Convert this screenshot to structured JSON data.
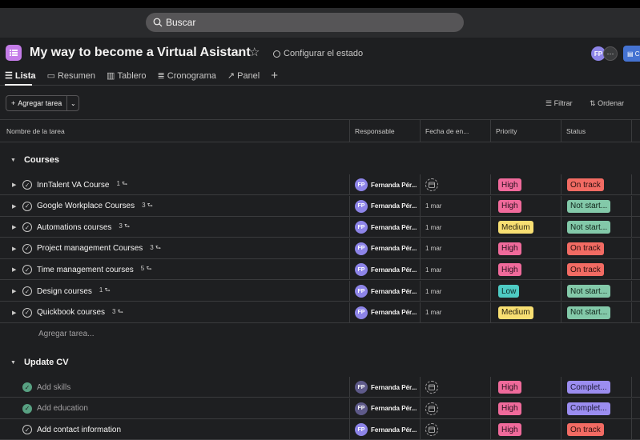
{
  "topbar": {
    "search_placeholder": "Buscar"
  },
  "project": {
    "title": "My way to become a Virtual Asistant",
    "status_cfg": "Configurar el estado",
    "avatar": "FP",
    "more": "···",
    "share_btn": "C"
  },
  "tabs": [
    {
      "label": "Lista",
      "icon": "list-icon"
    },
    {
      "label": "Resumen",
      "icon": "summary-icon"
    },
    {
      "label": "Tablero",
      "icon": "board-icon"
    },
    {
      "label": "Cronograma",
      "icon": "timeline-icon"
    },
    {
      "label": "Panel",
      "icon": "dashboard-icon"
    }
  ],
  "toolbar": {
    "add_task": "Agregar tarea",
    "filter": "Filtrar",
    "sort": "Ordenar"
  },
  "columns": {
    "name": "Nombre de la tarea",
    "assignee": "Responsable",
    "due": "Fecha de en...",
    "priority": "Priority",
    "status": "Status"
  },
  "sections": [
    {
      "title": "Courses",
      "tasks": [
        {
          "name": "InnTalent VA Course",
          "subtasks": "1",
          "assignee": "Fernanda Pér...",
          "initials": "FP",
          "date": "",
          "priority": "High",
          "status": "On track"
        },
        {
          "name": "Google Workplace Courses",
          "subtasks": "3",
          "assignee": "Fernanda Pér...",
          "initials": "FP",
          "date": "1 mar",
          "priority": "High",
          "status": "Not start..."
        },
        {
          "name": "Automations courses",
          "subtasks": "3",
          "assignee": "Fernanda Pér...",
          "initials": "FP",
          "date": "1 mar",
          "priority": "Medium",
          "status": "Not start..."
        },
        {
          "name": "Project management Courses",
          "subtasks": "3",
          "assignee": "Fernanda Pér...",
          "initials": "FP",
          "date": "1 mar",
          "priority": "High",
          "status": "On track"
        },
        {
          "name": "Time management courses",
          "subtasks": "5",
          "assignee": "Fernanda Pér...",
          "initials": "FP",
          "date": "1 mar",
          "priority": "High",
          "status": "On track"
        },
        {
          "name": "Design courses",
          "subtasks": "1",
          "assignee": "Fernanda Pér...",
          "initials": "FP",
          "date": "1 mar",
          "priority": "Low",
          "status": "Not start..."
        },
        {
          "name": "Quickbook courses",
          "subtasks": "3",
          "assignee": "Fernanda Pér...",
          "initials": "FP",
          "date": "1 mar",
          "priority": "Medium",
          "status": "Not start..."
        }
      ],
      "add_task_inline": "Agregar tarea..."
    },
    {
      "title": "Update CV",
      "tasks": [
        {
          "name": "Add skills",
          "subtasks": "",
          "assignee": "Fernanda Pér...",
          "initials": "FP",
          "date": "",
          "priority": "High",
          "status": "Complet..."
        },
        {
          "name": "Add education",
          "subtasks": "",
          "assignee": "Fernanda Pér...",
          "initials": "FP",
          "date": "",
          "priority": "High",
          "status": "Complet..."
        },
        {
          "name": "Add contact information",
          "subtasks": "",
          "assignee": "Fernanda Pér...",
          "initials": "FP",
          "date": "",
          "priority": "High",
          "status": "On track"
        }
      ]
    }
  ],
  "colors": {
    "high": "#f06a9b",
    "medium": "#f8df72",
    "low": "#4ecbc4",
    "on_track": "#f26b63",
    "not_started": "#83c9a9",
    "complete": "#9b8df0",
    "avatar": "#8d84e8"
  }
}
